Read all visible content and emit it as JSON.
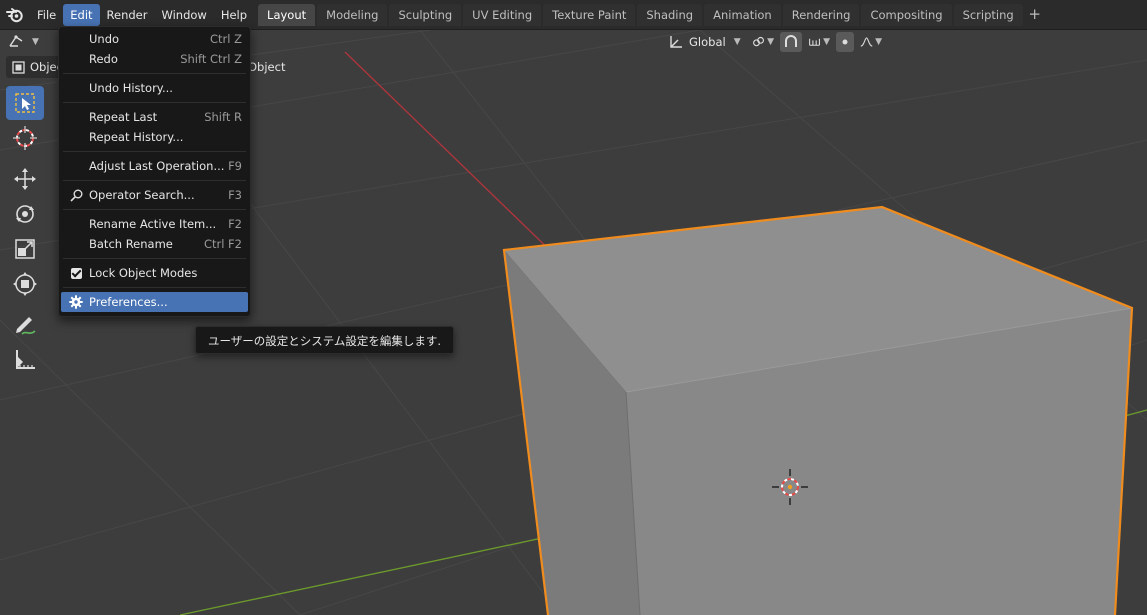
{
  "topbar": {
    "menus": [
      "File",
      "Edit",
      "Render",
      "Window",
      "Help"
    ],
    "active_menu": "Edit",
    "workspace_tabs": [
      "Layout",
      "Modeling",
      "Sculpting",
      "UV Editing",
      "Texture Paint",
      "Shading",
      "Animation",
      "Rendering",
      "Compositing",
      "Scripting"
    ],
    "active_tab": "Layout",
    "add_tab_label": "+"
  },
  "viewport_header": {
    "transform_orientation": "Global",
    "mode_label": "Objec",
    "object_menu_label": "Object"
  },
  "edit_menu": {
    "groups": [
      [
        {
          "label": "Undo",
          "shortcut": "Ctrl Z"
        },
        {
          "label": "Redo",
          "shortcut": "Shift Ctrl Z"
        }
      ],
      [
        {
          "label": "Undo History...",
          "shortcut": ""
        }
      ],
      [
        {
          "label": "Repeat Last",
          "shortcut": "Shift R"
        },
        {
          "label": "Repeat History...",
          "shortcut": ""
        }
      ],
      [
        {
          "label": "Adjust Last Operation...",
          "shortcut": "F9"
        }
      ],
      [
        {
          "label": "Operator Search...",
          "shortcut": "F3",
          "icon": "search-icon"
        }
      ],
      [
        {
          "label": "Rename Active Item...",
          "shortcut": "F2"
        },
        {
          "label": "Batch Rename",
          "shortcut": "Ctrl F2"
        }
      ],
      [
        {
          "label": "Lock Object Modes",
          "shortcut": "",
          "icon": "checkbox-checked-icon"
        }
      ],
      [
        {
          "label": "Preferences...",
          "shortcut": "",
          "icon": "gear-icon",
          "highlighted": true
        }
      ]
    ]
  },
  "tooltip": {
    "text": "ユーザーの設定とシステム設定を編集します."
  },
  "toolbar": {
    "tools": [
      "select-box-icon",
      "cursor-icon",
      "move-icon",
      "rotate-icon",
      "scale-icon",
      "transform-icon",
      "annotate-icon",
      "measure-icon"
    ],
    "active_tool": "select-box-icon"
  },
  "colors": {
    "accent": "#4772b3",
    "menu_bg": "#181818",
    "selection_outline": "#f08c1e",
    "x_axis": "#b0353c",
    "y_axis": "#6c9a2b",
    "cube_face": "#8c8c8c"
  }
}
